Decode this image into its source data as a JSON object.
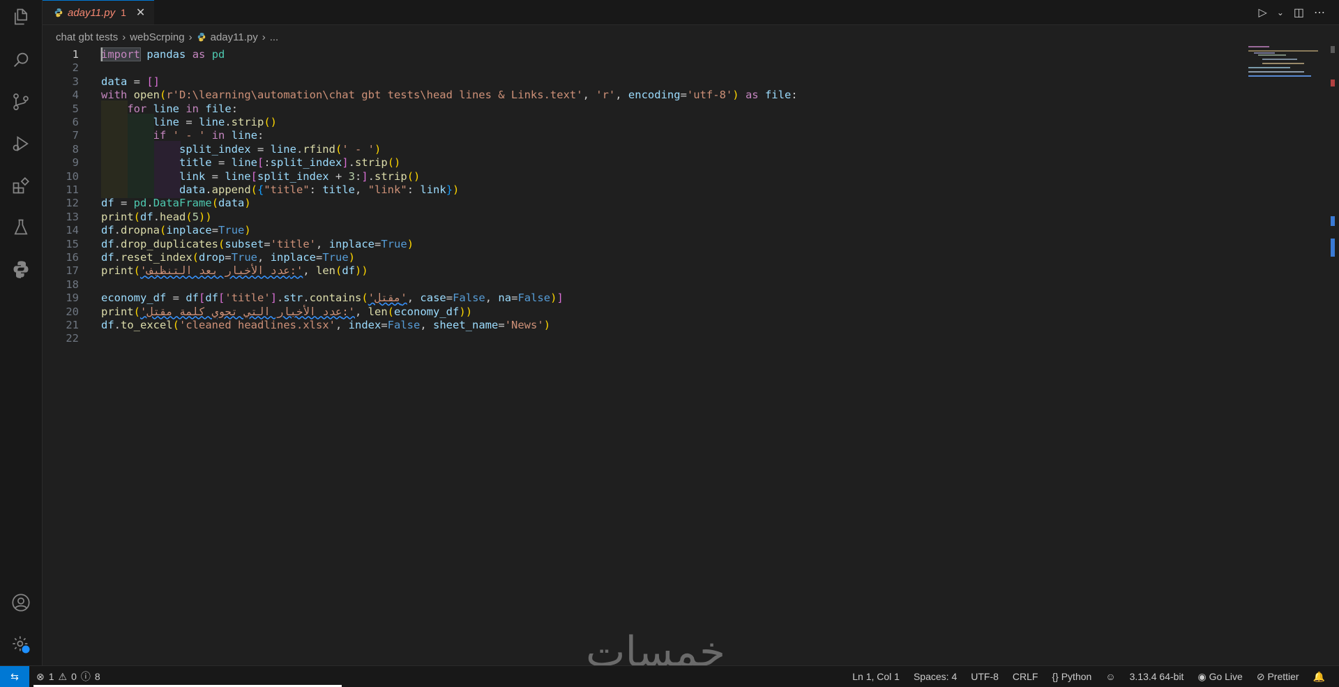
{
  "tab": {
    "filename": "aday11.py",
    "problem_count": "1",
    "close": "✕"
  },
  "editor_actions": {
    "run": "▷",
    "run_dropdown": "⌄",
    "split": "◫",
    "more": "⋯"
  },
  "breadcrumb": [
    "chat gbt tests",
    "webScrping",
    "aday11.py",
    "..."
  ],
  "code_lines": [
    "import pandas as pd",
    "",
    "data = []",
    "with open(r'D:\\learning\\automation\\chat gbt tests\\head lines & Links.text', 'r', encoding='utf-8') as file:",
    "    for line in file:",
    "        line = line.strip()",
    "        if ' - ' in line:",
    "            split_index = line.rfind(' - ')",
    "            title = line[:split_index].strip()",
    "            link = line[split_index + 3:].strip()",
    "            data.append({\"title\": title, \"link\": link})",
    "df = pd.DataFrame(data)",
    "print(df.head(5))",
    "df.dropna(inplace=True)",
    "df.drop_duplicates(subset='title', inplace=True)",
    "df.reset_index(drop=True, inplace=True)",
    "print('عدد الأخبار بعد التنظيف:', len(df))",
    "",
    "economy_df = df[df['title'].str.contains('مقتل', case=False, na=False)]",
    "print('عدد الأخبار التي تحوي كلمة مقتل:', len(economy_df))",
    "df.to_excel('cleaned headlines.xlsx', index=False, sheet_name='News')",
    ""
  ],
  "line_numbers": [
    "1",
    "2",
    "3",
    "4",
    "5",
    "6",
    "7",
    "8",
    "9",
    "10",
    "11",
    "12",
    "13",
    "14",
    "15",
    "16",
    "17",
    "18",
    "19",
    "20",
    "21",
    "22"
  ],
  "watermark": "خمسات",
  "status": {
    "remote_icon": "⇆",
    "errors": "1",
    "warnings": "0",
    "infos": "8",
    "position": "Ln 1, Col 1",
    "spaces": "Spaces: 4",
    "encoding": "UTF-8",
    "eol": "CRLF",
    "language": "Python",
    "language_icon": "{}",
    "interpreter": "3.13.4 64-bit",
    "golive": "Go Live",
    "prettier": "Prettier"
  },
  "colors": {
    "accent": "#0078d4",
    "editor_bg": "#1f1f1f",
    "sidebar_bg": "#181818"
  }
}
